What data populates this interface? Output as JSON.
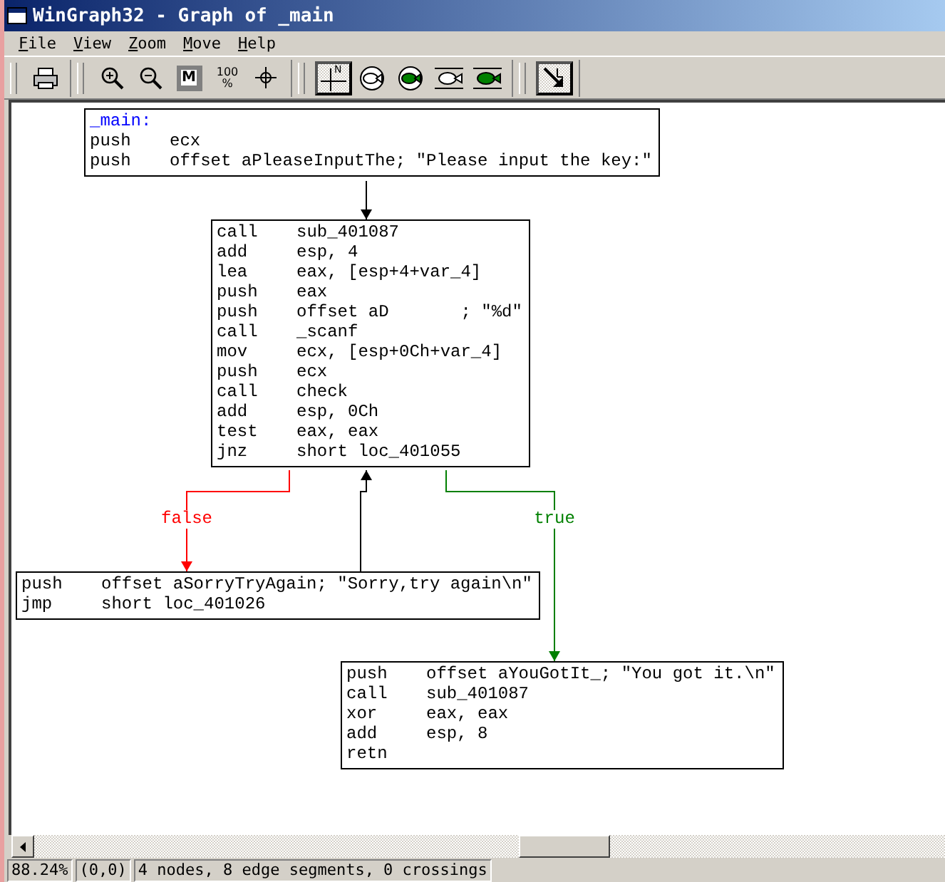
{
  "window": {
    "title": "WinGraph32 - Graph of _main"
  },
  "menu": [
    {
      "label": "File"
    },
    {
      "label": "View"
    },
    {
      "label": "Zoom"
    },
    {
      "label": "Move"
    },
    {
      "label": "Help"
    }
  ],
  "toolbar": [
    [
      {
        "kind": "print",
        "pressed": false
      }
    ],
    [
      {
        "kind": "zoom-in",
        "pressed": false
      },
      {
        "kind": "zoom-out",
        "pressed": false
      },
      {
        "kind": "fit",
        "label": "M",
        "pressed": false
      },
      {
        "kind": "actual-size",
        "label": "100",
        "sub": "%",
        "pressed": false
      },
      {
        "kind": "target",
        "pressed": false
      }
    ],
    [
      {
        "kind": "north",
        "label": "N",
        "pressed": true
      },
      {
        "kind": "fish",
        "color": "#ffffff",
        "pressed": false
      },
      {
        "kind": "fish",
        "color": "#008000",
        "pressed": false
      },
      {
        "kind": "fish-bars",
        "color": "#ffffff",
        "pressed": false
      },
      {
        "kind": "fish-bars",
        "color": "#008000",
        "pressed": false
      }
    ],
    [
      {
        "kind": "arrow",
        "pressed": true
      }
    ]
  ],
  "graph": {
    "nodes": [
      {
        "label": "_main:",
        "lines": [
          {
            "op": "push",
            "args": "ecx"
          },
          {
            "op": "push",
            "args": "offset aPleaseInputThe; \"Please input the key:\""
          }
        ]
      },
      {
        "lines": [
          {
            "op": "call",
            "args": "sub_401087"
          },
          {
            "op": "add",
            "args": "esp, 4"
          },
          {
            "op": "lea",
            "args": "eax, [esp+4+var_4]"
          },
          {
            "op": "push",
            "args": "eax"
          },
          {
            "op": "push",
            "args": "offset aD       ; \"%d\""
          },
          {
            "op": "call",
            "args": "_scanf"
          },
          {
            "op": "mov",
            "args": "ecx, [esp+0Ch+var_4]"
          },
          {
            "op": "push",
            "args": "ecx"
          },
          {
            "op": "call",
            "args": "check"
          },
          {
            "op": "add",
            "args": "esp, 0Ch"
          },
          {
            "op": "test",
            "args": "eax, eax"
          },
          {
            "op": "jnz",
            "args": "short loc_401055"
          }
        ]
      },
      {
        "lines": [
          {
            "op": "push",
            "args": "offset aSorryTryAgain; \"Sorry,try again\\n\""
          },
          {
            "op": "jmp",
            "args": "short loc_401026"
          }
        ]
      },
      {
        "lines": [
          {
            "op": "push",
            "args": "offset aYouGotIt_; \"You got it.\\n\""
          },
          {
            "op": "call",
            "args": "sub_401087"
          },
          {
            "op": "xor",
            "args": "eax, eax"
          },
          {
            "op": "add",
            "args": "esp, 8"
          },
          {
            "op": "retn"
          }
        ]
      }
    ],
    "edges": [
      {
        "kind": "normal"
      },
      {
        "kind": "false",
        "label": "false"
      },
      {
        "kind": "true",
        "label": "true"
      },
      {
        "kind": "normal"
      }
    ]
  },
  "status_bar": [
    "88.24%",
    "(0,0)",
    "4 nodes, 8 edge segments, 0 crossings"
  ]
}
